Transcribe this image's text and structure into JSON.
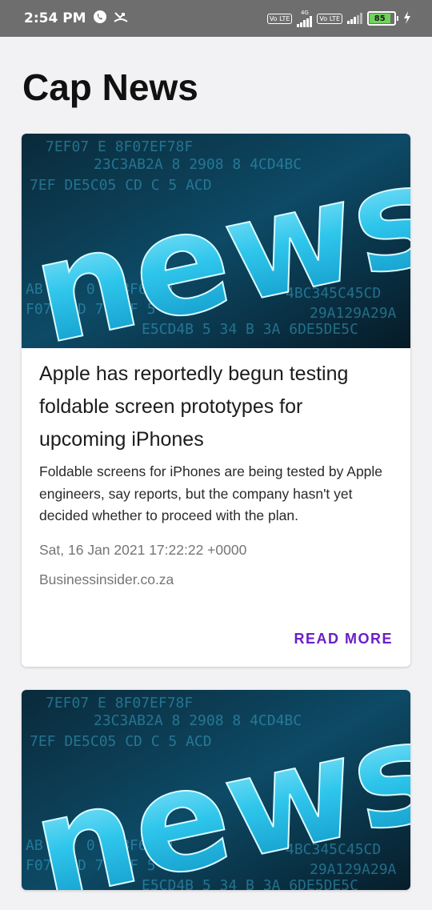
{
  "status_bar": {
    "time": "2:54 PM",
    "sim1_label": "Vo LTE",
    "network_type": "4G",
    "sim2_label": "Vo LTE",
    "battery_level": "85"
  },
  "app": {
    "title": "Cap News"
  },
  "articles": [
    {
      "image_text": "news",
      "headline": " Apple has reportedly begun testing foldable screen prototypes for upcoming iPhones",
      "description": "Foldable screens for iPhones are being tested by Apple engineers, say reports, but the company hasn't yet decided whether to proceed with the plan.",
      "date": "Sat, 16 Jan 2021 17:22:22 +0000",
      "source": "Businessinsider.co.za",
      "read_more_label": "READ MORE"
    },
    {
      "image_text": "news"
    }
  ],
  "colors": {
    "accent": "#6a1fc7",
    "status_bar_bg": "#6e6e6e",
    "page_bg": "#f2f2f4"
  }
}
